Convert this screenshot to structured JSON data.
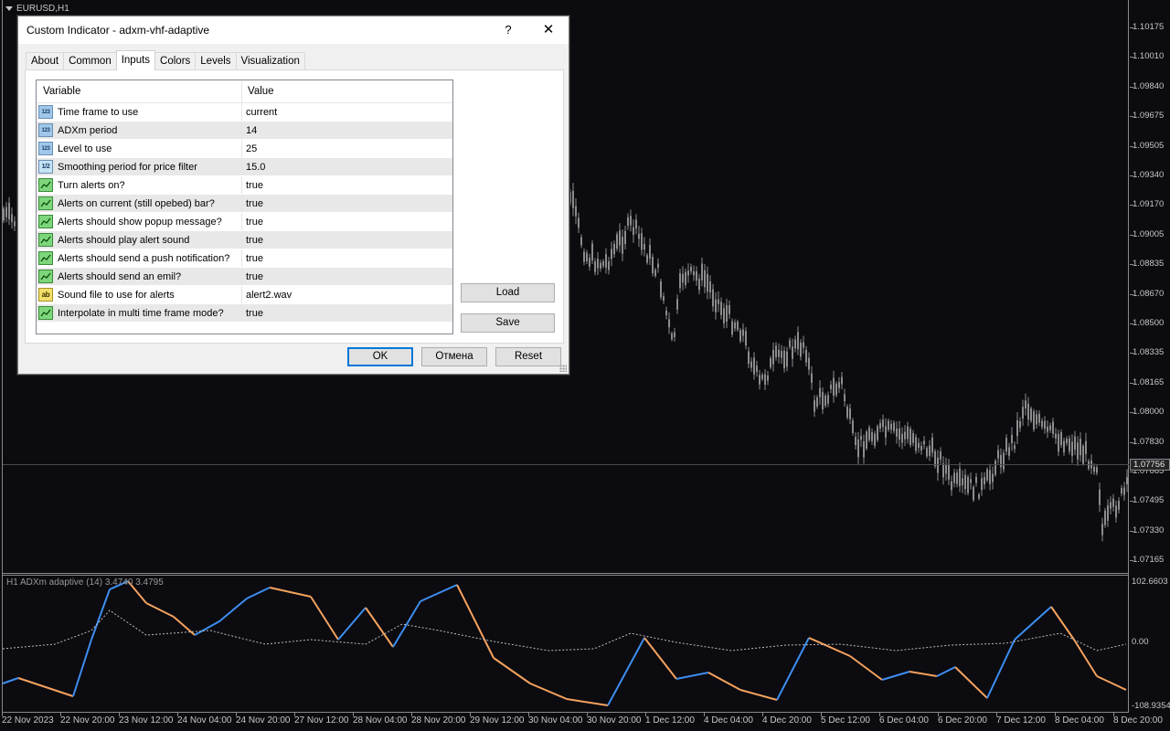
{
  "chart": {
    "symbol_title": "EURUSD,H1",
    "indicator_title": "H1 ADXm adaptive (14) 3.4740 3.4795",
    "current_price": "1.07756",
    "price_ticks": [
      "1.10175",
      "1.10010",
      "1.09840",
      "1.09675",
      "1.09505",
      "1.09340",
      "1.09170",
      "1.09005",
      "1.08835",
      "1.08670",
      "1.08500",
      "1.08335",
      "1.08165",
      "1.08000",
      "1.07830",
      "1.07665",
      "1.07495",
      "1.07330",
      "1.07165"
    ],
    "indicator_ticks": {
      "top": "102.6603",
      "mid": "0.00",
      "bottom": "-108.9354"
    },
    "time_labels": [
      "22 Nov 2023",
      "22 Nov 20:00",
      "23 Nov 12:00",
      "24 Nov 04:00",
      "24 Nov 20:00",
      "27 Nov 12:00",
      "28 Nov 04:00",
      "28 Nov 20:00",
      "29 Nov 12:00",
      "30 Nov 04:00",
      "30 Nov 20:00",
      "1 Dec 12:00",
      "4 Dec 04:00",
      "4 Dec 20:00",
      "5 Dec 12:00",
      "6 Dec 04:00",
      "6 Dec 20:00",
      "7 Dec 12:00",
      "8 Dec 04:00",
      "8 Dec 20:00"
    ],
    "colors": {
      "background": "#0b0b10",
      "candles": "#8c8c8c",
      "adx_up": "#3d8ef0",
      "adx_down": "#f5a25d",
      "level_line": "#bdbdbd"
    }
  },
  "dialog": {
    "title": "Custom Indicator - adxm-vhf-adaptive",
    "help_label": "?",
    "close_label": "✕",
    "tabs": [
      "About",
      "Common",
      "Inputs",
      "Colors",
      "Levels",
      "Visualization"
    ],
    "active_tab": "Inputs",
    "grid_headers": {
      "variable": "Variable",
      "value": "Value"
    },
    "inputs": [
      {
        "icon": "int-type-icon",
        "type_label": "123",
        "variable": "Time frame to use",
        "value": "current"
      },
      {
        "icon": "int-type-icon",
        "type_label": "123",
        "variable": "ADXm period",
        "value": "14"
      },
      {
        "icon": "int-type-icon",
        "type_label": "123",
        "variable": "Level to use",
        "value": "25"
      },
      {
        "icon": "double-type-icon",
        "type_label": "1/2",
        "variable": "Smoothing period for price filter",
        "value": "15.0"
      },
      {
        "icon": "bool-type-icon",
        "type_label": "",
        "variable": "Turn alerts on?",
        "value": "true"
      },
      {
        "icon": "bool-type-icon",
        "type_label": "",
        "variable": "Alerts on current (still opebed) bar?",
        "value": "true"
      },
      {
        "icon": "bool-type-icon",
        "type_label": "",
        "variable": "Alerts should show popup message?",
        "value": "true"
      },
      {
        "icon": "bool-type-icon",
        "type_label": "",
        "variable": "Alerts should play alert sound",
        "value": "true"
      },
      {
        "icon": "bool-type-icon",
        "type_label": "",
        "variable": "Alerts should send a push notification?",
        "value": "true"
      },
      {
        "icon": "bool-type-icon",
        "type_label": "",
        "variable": "Alerts should send an emil?",
        "value": "true"
      },
      {
        "icon": "string-type-icon",
        "type_label": "ab",
        "variable": "Sound file to use for alerts",
        "value": "alert2.wav"
      },
      {
        "icon": "bool-type-icon",
        "type_label": "",
        "variable": "Interpolate in multi time frame mode?",
        "value": "true"
      }
    ],
    "buttons": {
      "load": "Load",
      "save": "Save",
      "ok": "OK",
      "cancel": "Отмена",
      "reset": "Reset"
    }
  }
}
